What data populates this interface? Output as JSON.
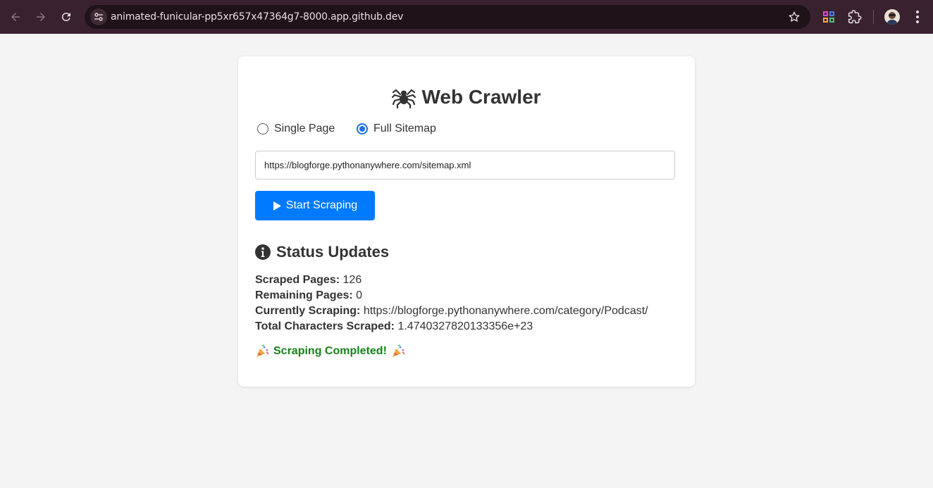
{
  "browser": {
    "url": "animated-funicular-pp5xr657x47364g7-8000.app.github.dev"
  },
  "app": {
    "title": "Web Crawler",
    "mode_options": [
      {
        "label": "Single Page",
        "selected": false
      },
      {
        "label": "Full Sitemap",
        "selected": true
      }
    ],
    "url_input_value": "https://blogforge.pythonanywhere.com/sitemap.xml",
    "start_button_label": "Start Scraping",
    "accent_color": "#007bff"
  },
  "status": {
    "heading": "Status Updates",
    "scraped_label": "Scraped Pages:",
    "scraped_value": "126",
    "remaining_label": "Remaining Pages:",
    "remaining_value": "0",
    "current_label": "Currently Scraping:",
    "current_value": "https://blogforge.pythonanywhere.com/category/Podcast/",
    "chars_label": "Total Characters Scraped:",
    "chars_value": "1.4740327820133356e+23",
    "completed_message": "Scraping Completed!",
    "completed_color": "#16821a"
  }
}
